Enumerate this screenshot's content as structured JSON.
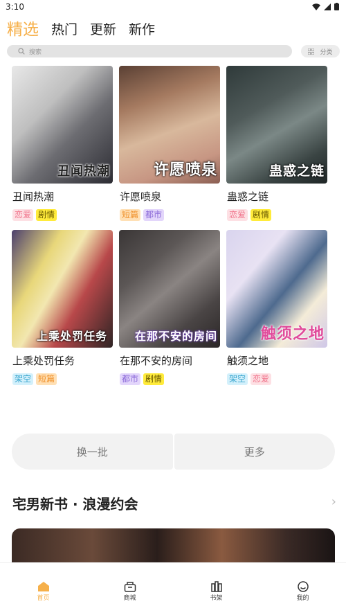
{
  "status": {
    "time": "3:10"
  },
  "tabs": [
    {
      "label": "精选",
      "active": true
    },
    {
      "label": "热门"
    },
    {
      "label": "更新"
    },
    {
      "label": "新作"
    }
  ],
  "search": {
    "placeholder": "搜索"
  },
  "category_button": {
    "label": "分类"
  },
  "comics": [
    {
      "title": "丑闻热潮",
      "cover_text": "丑闻热潮",
      "tags": [
        {
          "label": "恋爱",
          "color": "pink"
        },
        {
          "label": "剧情",
          "color": "yellow"
        }
      ]
    },
    {
      "title": "许愿喷泉",
      "cover_text": "许愿喷泉",
      "tags": [
        {
          "label": "短篇",
          "color": "orange"
        },
        {
          "label": "都市",
          "color": "purple"
        }
      ]
    },
    {
      "title": "蛊惑之链",
      "cover_text": "蛊惑之链",
      "tags": [
        {
          "label": "恋爱",
          "color": "pink"
        },
        {
          "label": "剧情",
          "color": "yellow"
        }
      ]
    },
    {
      "title": "上乘处罚任务",
      "cover_text": "上乘处罚任务",
      "tags": [
        {
          "label": "架空",
          "color": "cyan"
        },
        {
          "label": "短篇",
          "color": "orange"
        }
      ]
    },
    {
      "title": "在那不安的房间",
      "cover_text": "在那不安的房间",
      "tags": [
        {
          "label": "都市",
          "color": "purple"
        },
        {
          "label": "剧情",
          "color": "yellow"
        }
      ]
    },
    {
      "title": "触须之地",
      "cover_text": "触须之地",
      "tags": [
        {
          "label": "架空",
          "color": "cyan"
        },
        {
          "label": "恋爱",
          "color": "pink"
        }
      ]
    }
  ],
  "actions": {
    "refresh_label": "换一批",
    "more_label": "更多"
  },
  "section": {
    "title": "宅男新书 · 浪漫约会"
  },
  "bottom_nav": [
    {
      "label": "首页",
      "icon": "home-icon",
      "active": true
    },
    {
      "label": "商城",
      "icon": "shop-icon"
    },
    {
      "label": "书架",
      "icon": "bookshelf-icon"
    },
    {
      "label": "我的",
      "icon": "profile-icon"
    }
  ],
  "colors": {
    "accent": "#f6b04a"
  }
}
